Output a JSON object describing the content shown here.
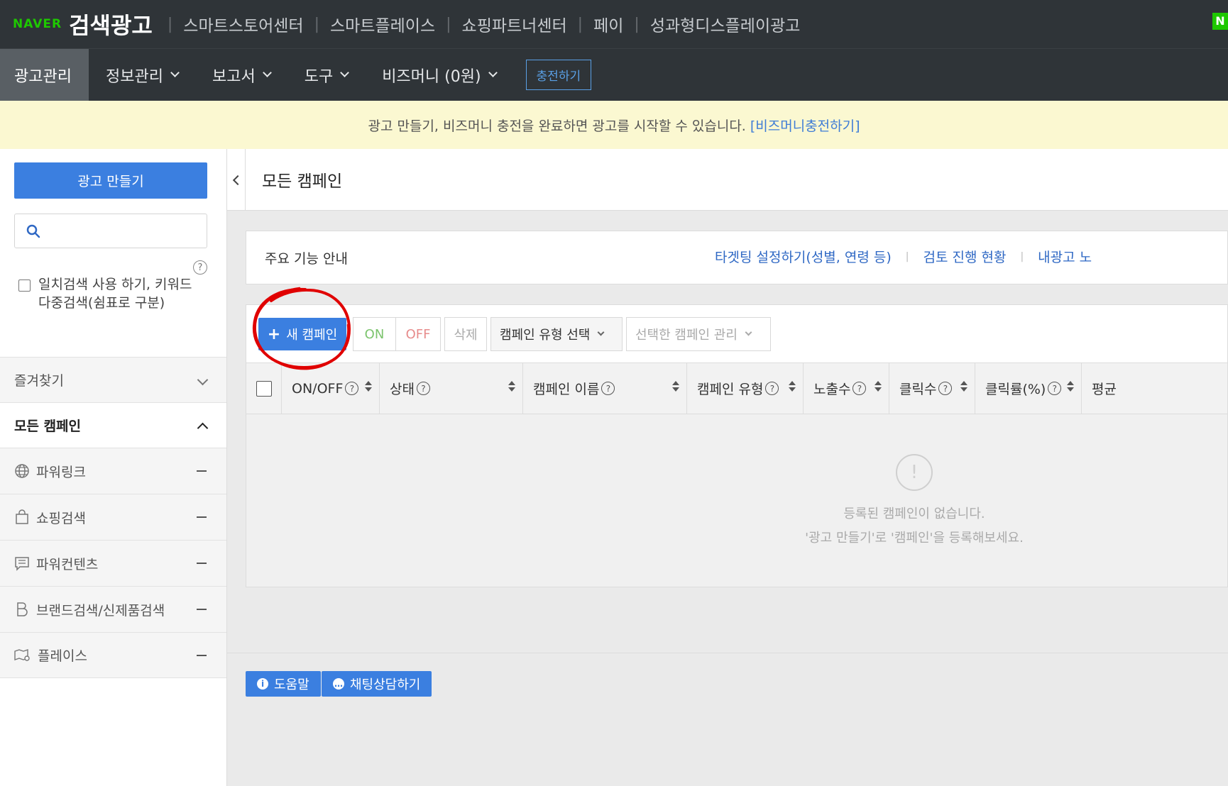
{
  "topbar": {
    "naver": "NAVER",
    "product": "검색광고",
    "links": [
      "스마트스토어센터",
      "스마트플레이스",
      "쇼핑파트너센터",
      "페이",
      "성과형디스플레이광고"
    ],
    "corner": "N"
  },
  "mainnav": {
    "items": [
      "광고관리",
      "정보관리",
      "보고서",
      "도구",
      "비즈머니 (0원)"
    ],
    "charge": "충전하기"
  },
  "notice": {
    "text": "광고 만들기, 비즈머니 충전을 완료하면 광고를 시작할 수 있습니다.",
    "link": "[비즈머니충전하기]"
  },
  "sidebar": {
    "create": "광고 만들기",
    "search_value": "",
    "help": "?",
    "exact_search": "일치검색 사용 하기, 키워드 다중검색(쉼표로 구분)",
    "favorites": "즐겨찾기",
    "all_campaigns": "모든 캠페인",
    "campaign_types": [
      "파워링크",
      "쇼핑검색",
      "파워컨텐츠",
      "브랜드검색/신제품검색",
      "플레이스"
    ]
  },
  "content": {
    "title": "모든 캠페인",
    "guide": {
      "title": "주요 기능 안내",
      "links": [
        "타겟팅 설정하기(성별, 연령 등)",
        "검토 진행 현황",
        "내광고 노"
      ]
    },
    "toolbar": {
      "new_campaign": "새 캠페인",
      "on": "ON",
      "off": "OFF",
      "delete": "삭제",
      "type_select": "캠페인 유형 선택",
      "manage": "선택한 캠페인 관리"
    },
    "columns": [
      "ON/OFF",
      "상태",
      "캠페인 이름",
      "캠페인 유형",
      "노출수",
      "클릭수",
      "클릭률(%)",
      "평균"
    ],
    "empty": {
      "icon": "!",
      "line1": "등록된 캠페인이 없습니다.",
      "line2": "'광고 만들기'로 '캠페인'을 등록해보세요."
    },
    "footer": {
      "help": "도움말",
      "chat": "채팅상담하기"
    }
  },
  "colors": {
    "topbar": "#2f3438",
    "accent": "#3b7fe0",
    "notice": "#fbf8d1",
    "annotation": "#e00000"
  }
}
